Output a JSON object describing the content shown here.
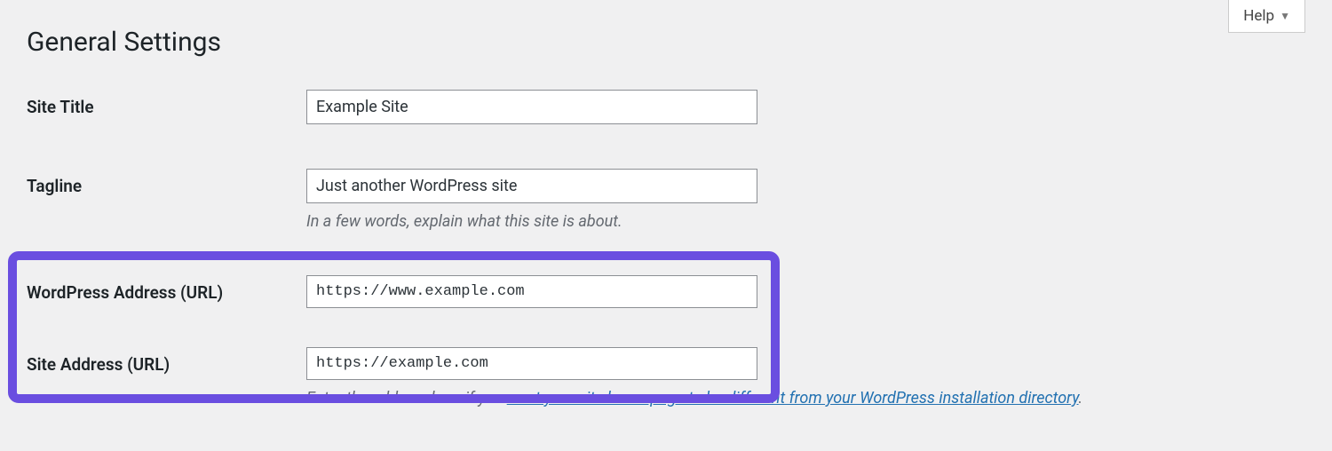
{
  "help": {
    "label": "Help"
  },
  "page": {
    "title": "General Settings"
  },
  "fields": {
    "site_title": {
      "label": "Site Title",
      "value": "Example Site"
    },
    "tagline": {
      "label": "Tagline",
      "value": "Just another WordPress site",
      "description": "In a few words, explain what this site is about."
    },
    "wp_url": {
      "label": "WordPress Address (URL)",
      "value": "https://www.example.com"
    },
    "site_url": {
      "label": "Site Address (URL)",
      "value": "https://example.com",
      "description_before": "Enter the address here if you ",
      "description_link": "want your site home page to be different from your WordPress installation directory",
      "description_after": "."
    }
  },
  "highlight": {
    "color": "#6a4ee0"
  }
}
